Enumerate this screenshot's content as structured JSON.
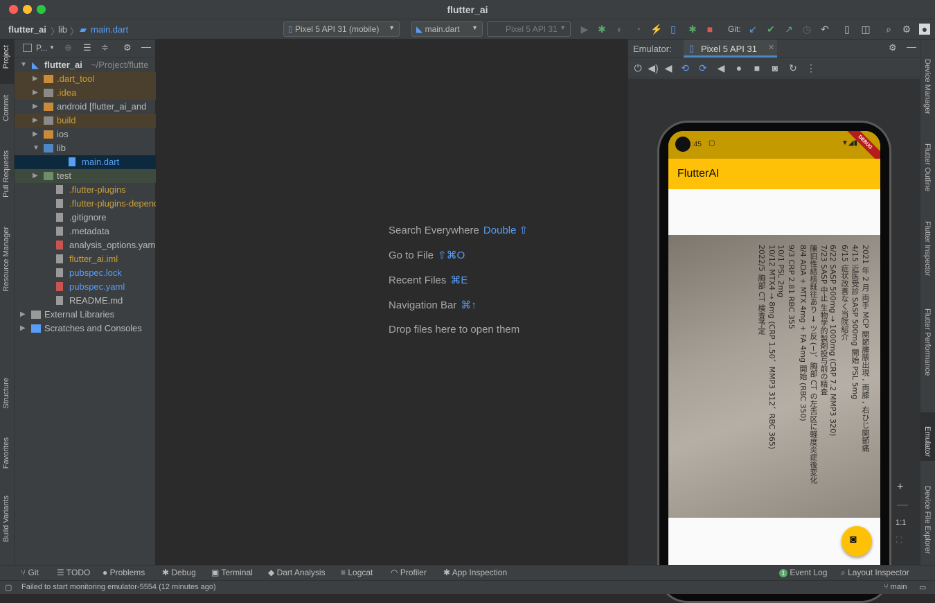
{
  "window": {
    "title": "flutter_ai"
  },
  "breadcrumb": {
    "project": "flutter_ai",
    "folder": "lib",
    "file": "main.dart"
  },
  "toolbar": {
    "device": "Pixel 5 API 31 (mobile)",
    "config": "main.dart",
    "target": "Pixel 5 API 31",
    "git_label": "Git:"
  },
  "left_tabs": [
    "Project",
    "Commit",
    "Pull Requests",
    "Resource Manager",
    "Structure",
    "Favorites",
    "Build Variants"
  ],
  "project": {
    "header": "P...",
    "root_name": "flutter_ai",
    "root_path": "~/Project/flutte",
    "items": [
      {
        "label": ".dart_tool",
        "color": "#c9a03a"
      },
      {
        "label": ".idea",
        "color": "#c9a03a"
      },
      {
        "label": "android [flutter_ai_and",
        "color": "#bbbbbb"
      },
      {
        "label": "build",
        "color": "#c9a03a"
      },
      {
        "label": "ios",
        "color": "#bbbbbb"
      },
      {
        "label": "lib",
        "color": "#bbbbbb"
      },
      {
        "label": "main.dart",
        "color": "#589df6"
      },
      {
        "label": "test",
        "color": "#bbbbbb"
      },
      {
        "label": ".flutter-plugins",
        "color": "#c9a03a"
      },
      {
        "label": ".flutter-plugins-depend",
        "color": "#c9a03a"
      },
      {
        "label": ".gitignore",
        "color": "#bbbbbb"
      },
      {
        "label": ".metadata",
        "color": "#bbbbbb"
      },
      {
        "label": "analysis_options.yaml",
        "color": "#bbbbbb"
      },
      {
        "label": "flutter_ai.iml",
        "color": "#c9a03a"
      },
      {
        "label": "pubspec.lock",
        "color": "#589df6"
      },
      {
        "label": "pubspec.yaml",
        "color": "#589df6"
      },
      {
        "label": "README.md",
        "color": "#bbbbbb"
      },
      {
        "label": "External Libraries",
        "color": "#bbbbbb"
      },
      {
        "label": "Scratches and Consoles",
        "color": "#bbbbbb"
      }
    ]
  },
  "editor_hints": [
    {
      "label": "Search Everywhere",
      "key": "Double ⇧"
    },
    {
      "label": "Go to File",
      "key": "⇧⌘O"
    },
    {
      "label": "Recent Files",
      "key": "⌘E"
    },
    {
      "label": "Navigation Bar",
      "key": "⌘↑"
    },
    {
      "label": "Drop files here to open them",
      "key": ""
    }
  ],
  "emulator": {
    "label": "Emulator:",
    "tab": "Pixel 5 API 31"
  },
  "phone": {
    "time": ":45",
    "debug": "DEBUG",
    "app_title": "FlutterAI",
    "photo_lines": [
      "2021 年 2 月 両手 MCP 関節腫脹出現 , 両膝 , 右ひじ関節痛",
      "4/15 近医受診 SASP 500mg 開始 PSL 5mg",
      "6/15 症状改善なく当院紹介",
      "6/22 SASP 500mg → 1000mg (CRP 7.2 MMP3 320)",
      "7/23 SASP 中止 生物学的製剤投与前の精査",
      "陳旧性結核既往あり → ツ反 (−)、胸部 CT の左舌区に軽度炎症後変化",
      "8/4 ADA + MTX 4mg + FA 4mg 開始 (RBC 350)",
      "9/3 CRP 2.81 RBC 355",
      "10/1 PSL 2mg",
      "10/12 MTX4 → 8mg (CRP 1.50、MMP3 312、RBC 365)",
      "2022/5 胸部 CT 検査予定"
    ]
  },
  "zoom": {
    "ratio": "1:1"
  },
  "right_tabs": [
    "Device Manager",
    "Flutter Outline",
    "Flutter Inspector",
    "Flutter Performance",
    "Emulator",
    "Device File Explorer"
  ],
  "bottom_tabs": [
    "Git",
    "TODO",
    "Problems",
    "Debug",
    "Terminal",
    "Dart Analysis",
    "Logcat",
    "Profiler",
    "App Inspection"
  ],
  "bottom_right": {
    "event_log": "Event Log",
    "event_count": "1",
    "layout_inspector": "Layout Inspector"
  },
  "status": {
    "message": "Failed to start monitoring emulator-5554 (12 minutes ago)",
    "branch": "main"
  }
}
